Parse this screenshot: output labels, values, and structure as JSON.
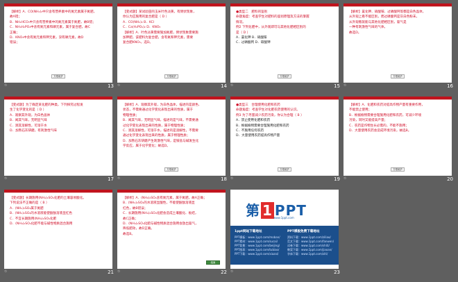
{
  "slides": [
    {
      "num": "13",
      "lines": [
        "【解析】A．CO(NH₂)₂中只含有营养素中的氮元素属于氮肥，",
        "故A错；",
        "B．NH₄HCO₃中只含有营养素中的氮元素属于氮肥，故B错；",
        "C．NH₄H₂PO₄中含有氮元素和磷元素，属于复合肥，故C",
        "正确；",
        "D．KNO₃中含有氮元素和钾元素，没有磷元素，故D",
        "错误；"
      ],
      "btn": "方框维护"
    },
    {
      "num": "14",
      "lines": [
        "【变式题】某试验田的玉米叶色淡黄，有倒伏现象，",
        "你认为应施用的复合肥是（ D ）",
        "A．CO(NH₂)₂          B．KCl",
        "C．Ca(H₂PO₄)₂        D．KNO₃",
        "",
        "【解析】A．叶色淡黄需要施加氮肥，倒伏现象需要施",
        "加钾肥，该肥料为复合肥，含有氮和钾元素，需要",
        "复合肥KNO₃，选D。"
      ],
      "btn": "方框维护"
    },
    {
      "num": "15",
      "lines": [
        "●类型二　肥料的鉴别",
        "命题角度：考查学生对肥料的鉴别原理及方法的掌握",
        "情况。",
        "例2  下列化肥中，从外观即可与其他化肥相区别的",
        "是（ D ）",
        "A．氯化钾           B．硝酸铵",
        "C．过磷酸钙         D．碳酸钾"
      ],
      "btn": "方框维护"
    },
    {
      "num": "16",
      "lines": [
        "【解析】氯化钾、硝酸铵、过磷酸钙等都是白色晶体，",
        "从外观上看不能区别，而过磷酸钙是灰白色粉末，",
        "从外观看就能与其他化肥相区别，氨气是",
        "一种有刺激性气味的气体。",
        "",
        "故选D。"
      ],
      "btn": "方框维护"
    },
    {
      "num": "17",
      "lines": [
        "【变式题】为了确定某化肥的种类，下列探究过程发",
        "生了化学变化的是（ D ）",
        "A．观察其外观，为白色晶体",
        "B．闻其气味，无明显气味",
        "C．测其溶解性，可溶于水",
        "D．加熟石灰研磨，有刺激性气味"
      ],
      "btn": ""
    },
    {
      "num": "18",
      "lines": [
        "【解析】A．观察其外观，为白色晶体，描述的是颜色、",
        "状态，不需要通过化学变化表现出来的性质，属于",
        "物理性质；",
        "B．闻其气味，无明显气味，描述的是气味，不需要通",
        "过化学变化表现出来的性质，属于物理性质；",
        "C．测其溶解性，可溶于水，描述的是溶解性，不需要",
        "通过化学变化表现出来的性质，属于物理性质；",
        "D．加熟石灰研磨产生刺激性气味，是铵盐与碱发生化",
        "学反应，属于化学变化；故选D。"
      ],
      "btn": "方框维护"
    },
    {
      "num": "19",
      "lines": [
        "●类型三　合理使用化肥和农药",
        "命题角度：考查学生对化肥农药使用的认识。",
        "例3  为了尽量减少农药污染，你认为合理（ B ）",
        "A．禁止使用化肥和农药",
        "B．根据植物需要合理施用化肥和农药",
        "C．不施用任何农药",
        "D．大量使用农药提高作物产量"
      ],
      "btn": "方框维护"
    },
    {
      "num": "20",
      "lines": [
        "【解析】A．化肥和农药对提高作物产量有重要作用，",
        "不能禁止使用；",
        "B．根据植物需要合理施用化肥和农药，可减少环境",
        "污染，同时又能提高产量；",
        "C．农药是作物生长必需的，不能不施用；",
        "D．大量使用农药会造成环境污染，故选B。"
      ],
      "btn": "方框维护"
    },
    {
      "num": "21",
      "lines": [
        "【变式题】长期施用(NH₄)₂SO₄化肥的土壤容易酸化。",
        "下列说法不正确的是（ B ）",
        "A．(NH₄)₂SO₄属于氮肥",
        "B．(NH₄)₂SO₄的水溶液能使酚酞溶液显红色",
        "C．不宜长期施用(NH₄)₂SO₄化肥",
        "D．(NH₄)₂SO₄化肥不能与碱性物质混合施用"
      ],
      "btn": ""
    },
    {
      "num": "22",
      "lines": [
        "【解析】A．(NH₄)₂SO₄含有氮元素，属于氮肥，故A正确；",
        "B．(NH₄)₂SO₄的水溶液显酸性，不能使酚酞溶液显",
        "红色，故B错误；",
        "C．长期施用(NH₄)₂SO₄化肥会造成土壤酸化、板结，",
        "故C正确；",
        "D．(NH₄)₂SO₄化肥与碱性物质混合施用会放出氨气，",
        "降低肥效，故D正确。",
        "故选B。"
      ],
      "btn": "结束"
    }
  ],
  "brand": {
    "num": "23",
    "logo_main": "第",
    "logo_one": "1",
    "logo_tail": "PPT",
    "logo_sub": "www.1ppt.com",
    "left_title": "1ppt网站下载地址",
    "right_title": "PPT模板免费下载地址",
    "left_links": [
      "PPT模板：www.1ppt.com/moban/",
      "PPT素材：www.1ppt.com/sucai/",
      "PPT背景：www.1ppt.com/beijing/",
      "PPT图表：www.1ppt.com/tubiao/",
      "PPT下载：www.1ppt.com/xiazai/"
    ],
    "right_links": [
      "资料下载：www.1ppt.com/ziliao/",
      "范文下载：www.1ppt.com/fanwen/",
      "试卷下载：www.1ppt.com/shiti/",
      "教案下载：www.1ppt.com/jiaoan/",
      "字体下载：www.1ppt.com/ziti/"
    ]
  }
}
